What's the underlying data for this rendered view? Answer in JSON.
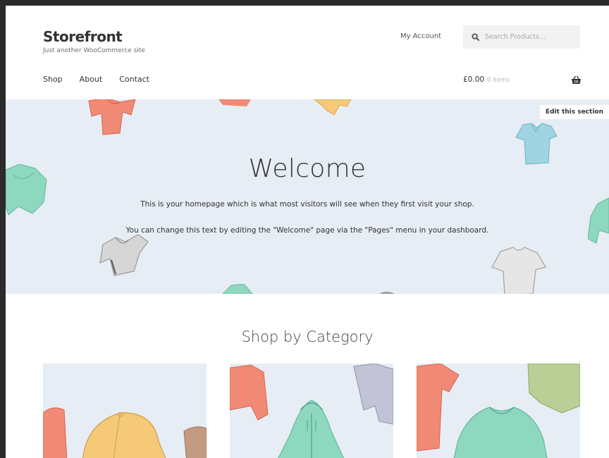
{
  "header": {
    "site_title": "Storefront",
    "tagline": "Just another WooCommerce site",
    "my_account": "My Account",
    "search_placeholder": "Search Products…"
  },
  "nav": {
    "items": [
      {
        "label": "Shop"
      },
      {
        "label": "About"
      },
      {
        "label": "Contact"
      }
    ]
  },
  "cart": {
    "total": "£0.00",
    "count": "0 items"
  },
  "hero": {
    "edit_label": "Edit this section",
    "title": "Welcome",
    "paragraph1": "This is your homepage which is what most visitors will see when they first visit your shop.",
    "paragraph2": "You can change this text by editing the \"Welcome\" page via the \"Pages\" menu in your dashboard."
  },
  "categories": {
    "heading": "Shop by Category"
  },
  "colors": {
    "hero_bg": "#e7edf4",
    "clothing_coral": "#f08a74",
    "clothing_mint": "#8fd8c0",
    "clothing_blue": "#9fd4e0",
    "clothing_gray": "#bfbfbf",
    "clothing_yellow": "#f5c978",
    "clothing_olive": "#b9cf95"
  }
}
